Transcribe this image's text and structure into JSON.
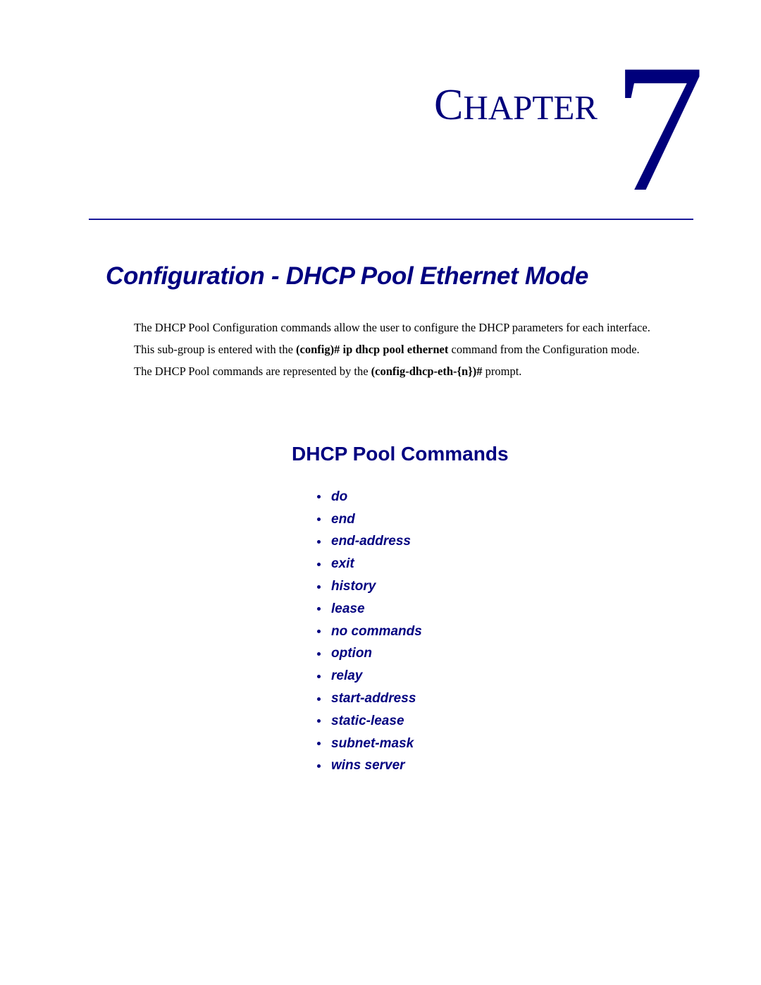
{
  "chapter": {
    "word_initial": "C",
    "word_rest": "HAPTER",
    "number": "7"
  },
  "page_title": "Configuration - DHCP Pool Ethernet Mode",
  "intro": {
    "p1": "The DHCP Pool Configuration commands allow the user to configure the DHCP parameters for each interface.",
    "p2_before": "This sub-group is entered with the ",
    "p2_bold": "(config)# ip dhcp pool ethernet",
    "p2_after": " command from the Configuration mode.",
    "p3_before": "The DHCP Pool commands are represented by the ",
    "p3_bold": "(config-dhcp-eth-{n})#",
    "p3_after": " prompt."
  },
  "section": {
    "title": "DHCP Pool Commands",
    "commands": [
      "do",
      "end",
      "end-address",
      "exit",
      "history",
      "lease",
      "no commands",
      "option",
      "relay",
      "start-address",
      "static-lease",
      "subnet-mask",
      "wins server"
    ]
  },
  "colors": {
    "heading_blue": "#000080",
    "text": "#000000",
    "rule": "#1a1a9a"
  }
}
